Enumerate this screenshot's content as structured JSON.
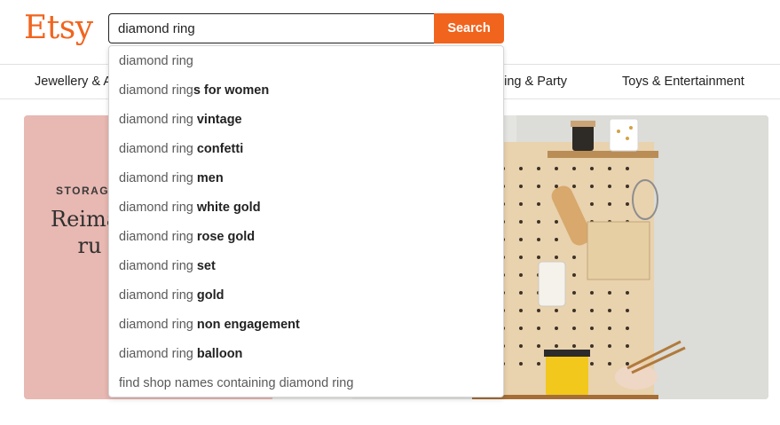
{
  "header": {
    "logo_text": "Etsy",
    "search": {
      "value": "diamond ring",
      "button_label": "Search"
    }
  },
  "nav": {
    "items": [
      {
        "label": "Jewellery & A"
      },
      {
        "label": "dding & Party"
      },
      {
        "label": "Toys & Entertainment"
      }
    ]
  },
  "hero": {
    "eyebrow": "STORAGE",
    "heading": "Reima\n    ru"
  },
  "autocomplete": {
    "suggestions": [
      {
        "base": "diamond ring",
        "bold": ""
      },
      {
        "base": "diamond ring",
        "bold": "s for women"
      },
      {
        "base": "diamond ring ",
        "bold": "vintage"
      },
      {
        "base": "diamond ring ",
        "bold": "confetti"
      },
      {
        "base": "diamond ring ",
        "bold": "men"
      },
      {
        "base": "diamond ring ",
        "bold": "white gold"
      },
      {
        "base": "diamond ring ",
        "bold": "rose gold"
      },
      {
        "base": "diamond ring ",
        "bold": "set"
      },
      {
        "base": "diamond ring ",
        "bold": "gold"
      },
      {
        "base": "diamond ring ",
        "bold": "non engagement"
      },
      {
        "base": "diamond ring ",
        "bold": "balloon"
      }
    ],
    "shop_search": "find shop names containing diamond ring"
  },
  "colors": {
    "brand": "#f1641e",
    "hero_panel": "#e8b8b2",
    "pegboard": "#e9d2ae"
  }
}
